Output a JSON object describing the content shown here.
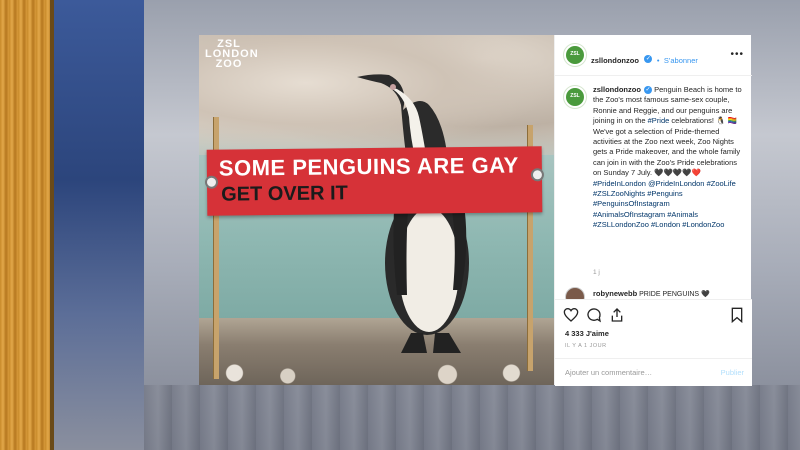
{
  "photo": {
    "logo_text": "ZSL LONDON ZOO",
    "banner_line1": "SOME PENGUINS ARE GAY",
    "banner_line2": "GET OVER IT"
  },
  "header": {
    "username": "zsllondonzoo",
    "verified_icon": "verified-badge-icon",
    "separator": "•",
    "follow_label": "S'abonner",
    "more_icon": "more-options-icon",
    "more_label": "•••"
  },
  "post": {
    "username": "zsllondonzoo",
    "caption_intro": "Penguin Beach is home to the Zoo's most famous same-sex couple, Ronnie and Reggie, and our penguins are joining in on the",
    "caption_hashtag_pride": "#Pride",
    "caption_mid": "celebrations! 🐧 🏳️‍🌈 We've got a selection of Pride-themed activities at the Zoo next week, Zoo Nights gets a Pride makeover, and the whole family can join in with the Zoo's Pride celebrations on Sunday 7 July. 🖤🖤🖤🖤❤️",
    "hashtag_prideinlondon": "#PrideInLondon",
    "mention_prideinlondon": "@PrideInLondon",
    "hashtags_rest": "#ZooLife #ZSLZooNights #Penguins #PenguinsOfInstagram #AnimalsOfInstagram #Animals #ZSLLondonZoo #London #LondonZoo",
    "time_ago": "1 j"
  },
  "comment": {
    "username": "robynewebb",
    "text": "PRIDE PENGUINS 🖤"
  },
  "actions": {
    "like_icon": "heart-icon",
    "comment_icon": "comment-icon",
    "share_icon": "share-icon",
    "save_icon": "bookmark-icon",
    "likes": "4 333 J'aime",
    "posted": "IL Y A 1 JOUR"
  },
  "add_comment": {
    "placeholder": "Ajouter un commentaire…",
    "post_label": "Publier"
  },
  "colors": {
    "accent_blue": "#3897f0",
    "hashtag": "#003569",
    "banner_red": "#d63238",
    "zsl_green": "#4a9a3c"
  }
}
